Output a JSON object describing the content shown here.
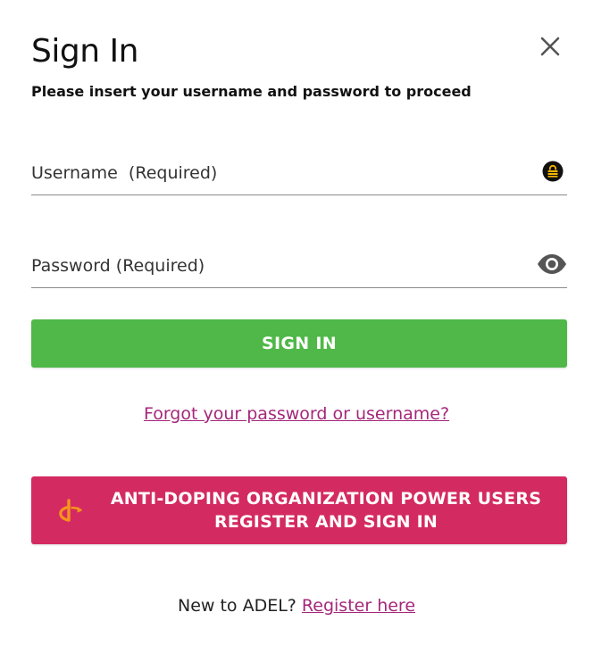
{
  "dialog": {
    "title": "Sign In",
    "subtitle": "Please insert your username and password to proceed",
    "close_icon": "close-icon"
  },
  "username": {
    "placeholder": "Username  (Required)",
    "value": "",
    "icon": "password-manager-lock-icon",
    "icon_color": "#f7b500"
  },
  "password": {
    "placeholder": "Password (Required)",
    "value": "",
    "icon": "eye-icon"
  },
  "actions": {
    "sign_in_label": "SIGN IN",
    "sign_in_color": "#4fb848",
    "forgot_label": "Forgot your password or username?",
    "ado_line1": "ANTI-DOPING ORGANIZATION POWER USERS",
    "ado_line2": "REGISTER AND SIGN IN",
    "ado_color": "#d42a62",
    "ado_icon": "openid-icon"
  },
  "footer": {
    "prompt": "New to ADEL?",
    "register_label": "Register here",
    "link_color": "#a4277a"
  }
}
